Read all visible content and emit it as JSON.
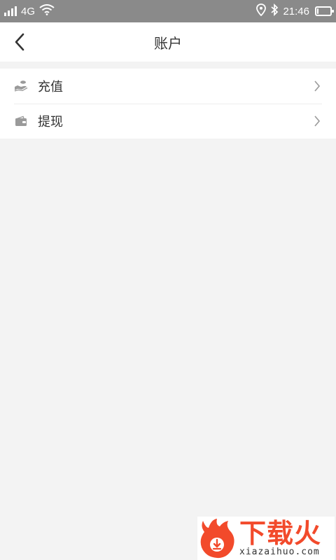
{
  "status_bar": {
    "network": "4G",
    "time": "21:46",
    "battery_level": 0.1
  },
  "header": {
    "title": "账户"
  },
  "menu": {
    "items": [
      {
        "label": "充值",
        "icon": "hand-coin-icon"
      },
      {
        "label": "提现",
        "icon": "wallet-icon"
      }
    ]
  },
  "watermark": {
    "brand_cn": "下载火",
    "brand_en": "xiazaihuo.com",
    "color": "#f24a2b"
  },
  "colors": {
    "status_bar": "#8a8a8a",
    "background": "#f3f3f3",
    "text": "#333333",
    "icon": "#9a9a9a"
  }
}
